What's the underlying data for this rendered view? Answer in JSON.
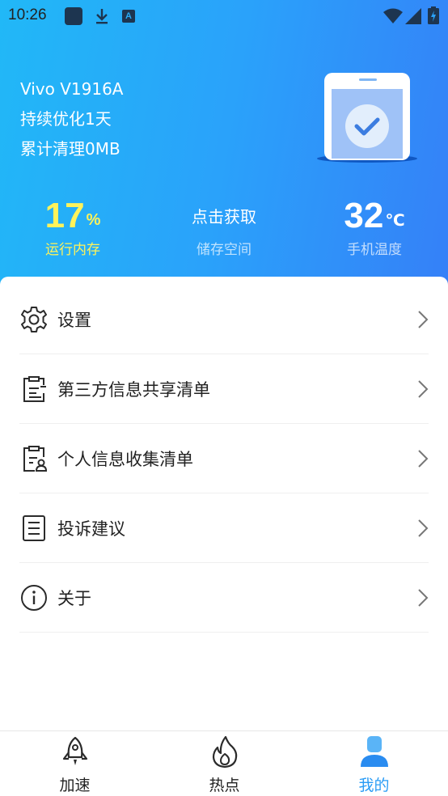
{
  "status_bar": {
    "time": "10:26",
    "left_icons": [
      "app-square-icon",
      "download-icon",
      "a-notification-icon"
    ],
    "right_icons": [
      "wifi-icon",
      "cell-signal-icon",
      "battery-charging-icon"
    ],
    "a_glyph": "A"
  },
  "device": {
    "model": "Vivo V1916A",
    "optimized": "持续优化1天",
    "cleaned": "累计清理0MB"
  },
  "stats": {
    "memory": {
      "value": "17",
      "unit": "%",
      "label": "运行内存"
    },
    "storage": {
      "value": "点击获取",
      "label": "储存空间"
    },
    "temperature": {
      "value": "32",
      "unit": "℃",
      "label": "手机温度"
    }
  },
  "menu": {
    "items": [
      {
        "label": "设置",
        "icon": "gear-icon"
      },
      {
        "label": "第三方信息共享清单",
        "icon": "clipboard-list-icon"
      },
      {
        "label": "个人信息收集清单",
        "icon": "clipboard-user-icon"
      },
      {
        "label": "投诉建议",
        "icon": "document-icon"
      },
      {
        "label": "关于",
        "icon": "info-icon"
      }
    ]
  },
  "bottom_nav": {
    "items": [
      {
        "label": "加速",
        "icon": "rocket-icon",
        "active": false
      },
      {
        "label": "热点",
        "icon": "flame-icon",
        "active": false
      },
      {
        "label": "我的",
        "icon": "user-icon",
        "active": true
      }
    ]
  },
  "colors": {
    "header_gradient_start": "#21b8f7",
    "header_gradient_end": "#3580f8",
    "memory_highlight": "#fff35a",
    "active_nav": "#2a9cf5"
  }
}
